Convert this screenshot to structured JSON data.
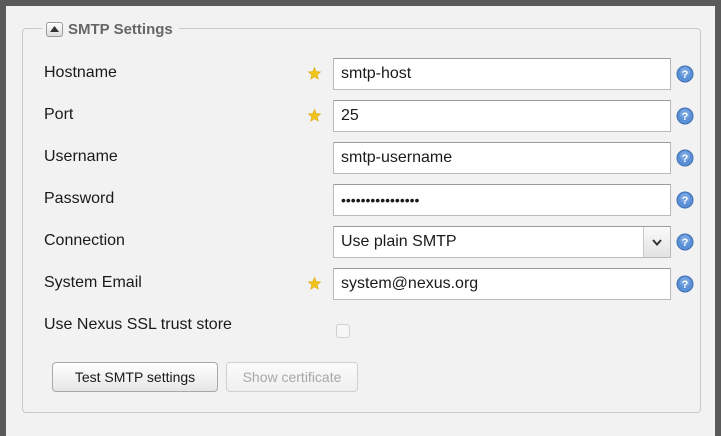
{
  "section": {
    "title": "SMTP Settings",
    "collapse_icon": "triangle-up-icon"
  },
  "fields": {
    "hostname": {
      "label": "Hostname",
      "value": "smtp-host",
      "required": true
    },
    "port": {
      "label": "Port",
      "value": "25",
      "required": true
    },
    "username": {
      "label": "Username",
      "value": "smtp-username",
      "required": false
    },
    "password": {
      "label": "Password",
      "value": "••••••••••••••••",
      "required": false
    },
    "connection": {
      "label": "Connection",
      "value": "Use plain SMTP",
      "required": false
    },
    "system_email": {
      "label": "System Email",
      "value": "system@nexus.org",
      "required": true
    },
    "ssl_trust": {
      "label": "Use Nexus SSL trust store",
      "checked": false,
      "disabled": true
    }
  },
  "buttons": {
    "test": "Test SMTP settings",
    "show_certificate": "Show certificate"
  },
  "colors": {
    "required_star": "#f0c419",
    "help_icon": "#5b8fd6",
    "frame": "#5a5a5a",
    "panel_bg": "#f2f2f2"
  }
}
